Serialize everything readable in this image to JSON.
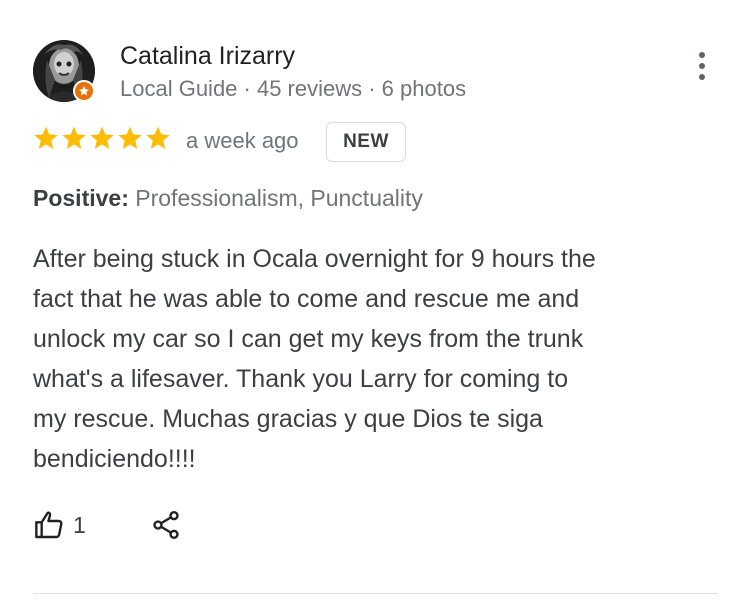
{
  "review": {
    "reviewer": {
      "name": "Catalina Irizarry",
      "meta": "Local Guide · 45 reviews · 6 photos",
      "badge": "local-guide-star-icon"
    },
    "rating": 5,
    "rating_max": 5,
    "time": "a week ago",
    "new_badge": "NEW",
    "positive_label": "Positive:",
    "positive_value": "Professionalism, Punctuality",
    "text": "After being stuck in Ocala overnight for 9 hours the\nfact that he was able to come and rescue me and\nunlock my car so I can get my keys from the trunk\nwhat's a lifesaver. Thank you Larry for coming to\nmy rescue. Muchas gracias y que Dios te siga\nbendiciendo!!!!",
    "like_count": "1"
  },
  "icons": {
    "more": "more-vert-icon",
    "like": "thumb-up-icon",
    "share": "share-icon",
    "star": "star-icon"
  },
  "colors": {
    "star": "#fbbc04",
    "badge_orange": "#e8710a",
    "text_primary": "#202124",
    "text_secondary": "#70757a"
  }
}
